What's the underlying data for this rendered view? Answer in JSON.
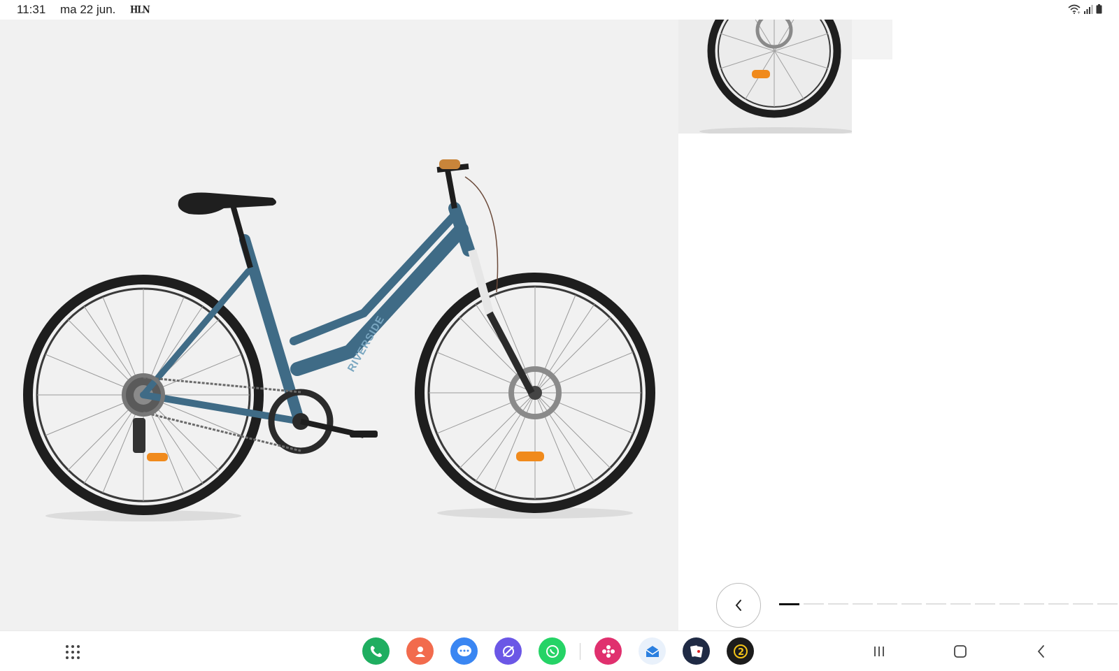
{
  "status_bar": {
    "time": "11:31",
    "date": "ma 22 jun.",
    "app_indicator": "HLN",
    "icons": [
      "wifi-icon",
      "signal-icon",
      "battery-icon"
    ]
  },
  "product_image": {
    "brand_text": "RIVERSIDE",
    "frame_color": "#3f6b86",
    "background_color": "#f1f1f1"
  },
  "carousel": {
    "prev_icon": "chevron-left-icon",
    "total_slides": 14,
    "active_slide": 1
  },
  "taskbar": {
    "apps": [
      {
        "name": "phone-app",
        "color": "#1fae60"
      },
      {
        "name": "contacts-app",
        "color": "#f26b4d"
      },
      {
        "name": "messages-app",
        "color": "#3a86f2"
      },
      {
        "name": "internet-app",
        "color": "#6b57e6"
      },
      {
        "name": "whatsapp-app",
        "color": "#25d366"
      },
      {
        "name": "gallery-app",
        "color": "#e0306e"
      },
      {
        "name": "email-app",
        "color": "#2a7fe0"
      },
      {
        "name": "solitaire-app",
        "color": "#2a2a2a"
      },
      {
        "name": "game-app",
        "color": "#1c1c1c"
      }
    ],
    "nav": [
      "recents-icon",
      "home-icon",
      "back-icon"
    ]
  }
}
